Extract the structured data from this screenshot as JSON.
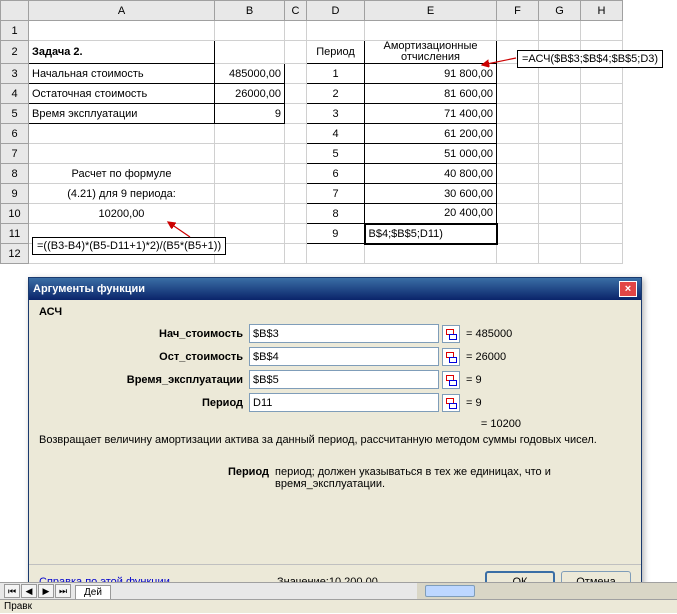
{
  "columns": [
    "A",
    "B",
    "C",
    "D",
    "E",
    "F",
    "G",
    "H"
  ],
  "rows": {
    "2": {
      "A": "Задача 2.",
      "D": "Период",
      "E": "Амортизационные отчисления"
    },
    "3": {
      "A": "Начальная стоимость",
      "B": "485000,00",
      "D": "1",
      "E": "91 800,00"
    },
    "4": {
      "A": "Остаточная стоимость",
      "B": "26000,00",
      "D": "2",
      "E": "81 600,00"
    },
    "5": {
      "A": "Время эксплуатации",
      "B": "9",
      "D": "3",
      "E": "71 400,00"
    },
    "6": {
      "D": "4",
      "E": "61 200,00"
    },
    "7": {
      "D": "5",
      "E": "51 000,00"
    },
    "8": {
      "A": "Расчет по формуле",
      "D": "6",
      "E": "40 800,00"
    },
    "9": {
      "A": "(4.21) для 9 периода:",
      "D": "7",
      "E": "30 600,00"
    },
    "10": {
      "A": "10200,00",
      "D": "8",
      "E": "20 400,00"
    },
    "11": {
      "D": "9",
      "E": "B$4;$B$5;D11)"
    }
  },
  "annot_left": "=((B3-B4)*(B5-D11+1)*2)/(B5*(B5+1))",
  "annot_right": "=АСЧ($B$3;$B$4;$B$5;D3)",
  "dialog": {
    "title": "Аргументы функции",
    "func": "АСЧ",
    "args": [
      {
        "label": "Нач_стоимость",
        "value": "$B$3",
        "result": "= 485000"
      },
      {
        "label": "Ост_стоимость",
        "value": "$B$4",
        "result": "= 26000"
      },
      {
        "label": "Время_эксплуатации",
        "value": "$B$5",
        "result": "= 9"
      },
      {
        "label": "Период",
        "value": "D11",
        "result": "= 9"
      }
    ],
    "total": "= 10200",
    "description": "Возвращает величину амортизации актива за данный период, рассчитанную методом суммы годовых чисел.",
    "param_label": "Период",
    "param_desc": "период; должен указываться в тех же единицах, что и время_эксплуатации.",
    "help": "Справка по этой функции",
    "value_label": "Значение:",
    "value": "10 200,00",
    "ok": "ОК",
    "cancel": "Отмена"
  },
  "sheet_tab": "Дей",
  "status": "Правк"
}
